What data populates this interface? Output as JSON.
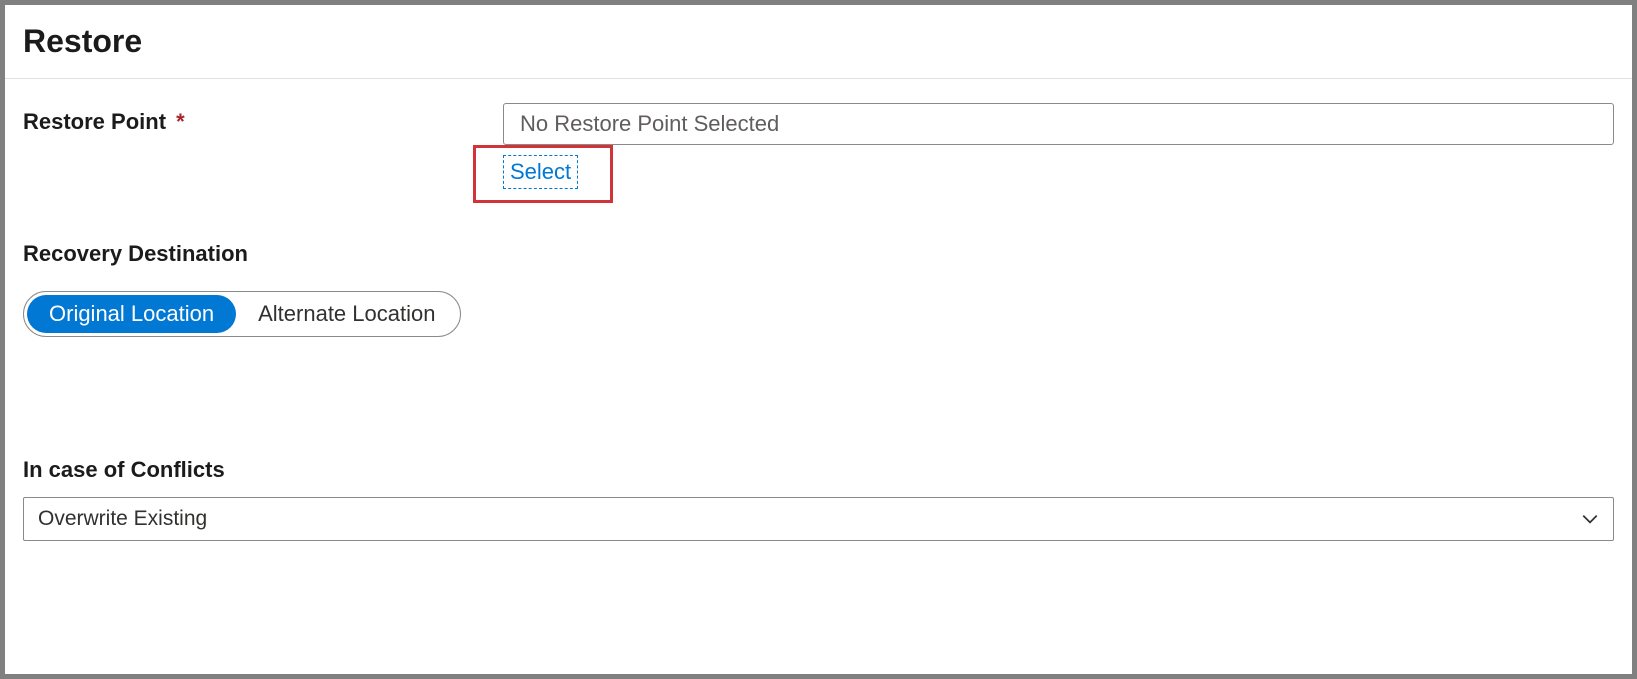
{
  "header": {
    "title": "Restore"
  },
  "restorePoint": {
    "label": "Restore Point",
    "requiredMark": "*",
    "value": "No Restore Point Selected",
    "selectLink": "Select"
  },
  "recoveryDestination": {
    "label": "Recovery Destination",
    "options": {
      "original": "Original Location",
      "alternate": "Alternate Location"
    }
  },
  "conflicts": {
    "label": "In case of Conflicts",
    "selected": "Overwrite Existing"
  }
}
